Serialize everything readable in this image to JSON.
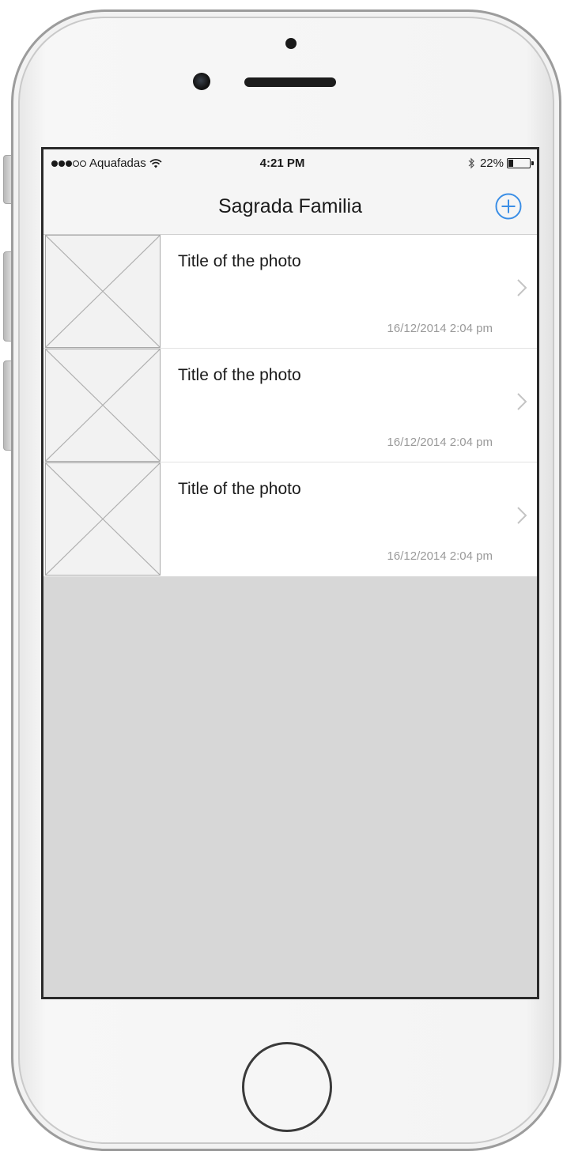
{
  "status_bar": {
    "carrier": "Aquafadas",
    "time": "4:21 PM",
    "battery": "22%",
    "battery_level": 0.22,
    "signal_bars": 3,
    "signal_total": 5
  },
  "nav": {
    "title": "Sagrada Familia",
    "add_icon": "plus-circle-icon"
  },
  "photos": [
    {
      "title": "Title of the photo",
      "date": "16/12/2014  2:04 pm"
    },
    {
      "title": "Title of the photo",
      "date": "16/12/2014  2:04 pm"
    },
    {
      "title": "Title of the photo",
      "date": "16/12/2014  2:04 pm"
    }
  ],
  "colors": {
    "accent": "#3a8ee6",
    "empty_area": "#d7d7d7"
  }
}
